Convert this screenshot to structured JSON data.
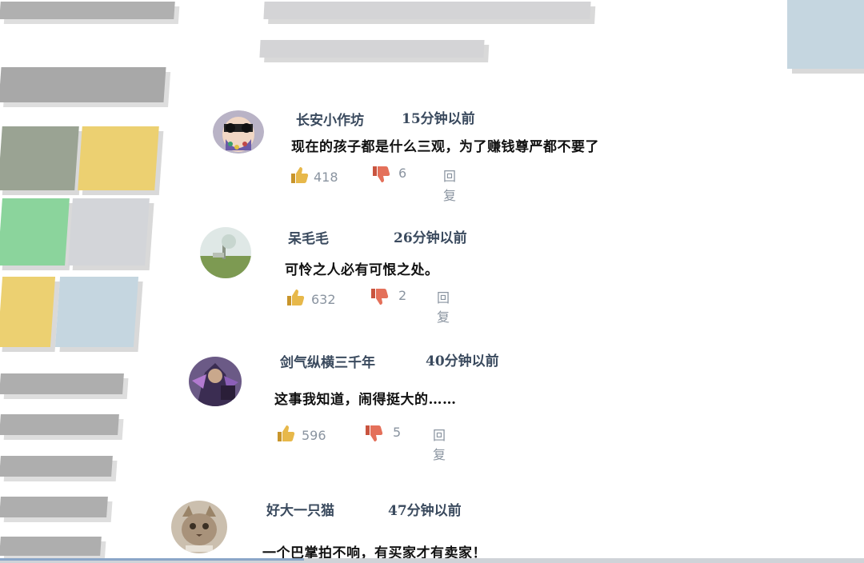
{
  "colors": {
    "gray_bar": "#9c9c9c",
    "light_gray": "#d4d4d6",
    "sage": "#9aa393",
    "yellow": "#ecd071",
    "green": "#8bd49c",
    "silver": "#d3d5d9",
    "light_blue": "#c5d6e0",
    "name_color": "#3a4a5e",
    "like_color": "#e7b84a",
    "dislike_color": "#e4705a"
  },
  "comments": [
    {
      "user": "长安小作坊",
      "time": "15分钟以前",
      "text": "现在的孩子都是什么三观，为了赚钱尊严都不要了",
      "likes": "418",
      "dislikes": "6",
      "reply": "回复",
      "avatar_icon": "sunglasses-avatar-icon"
    },
    {
      "user": "呆毛毛",
      "time": "26分钟以前",
      "text": "可怜之人必有可恨之处。",
      "likes": "632",
      "dislikes": "2",
      "reply": "回复",
      "avatar_icon": "landscape-avatar-icon"
    },
    {
      "user": "剑气纵横三千年",
      "time": "40分钟以前",
      "text": "这事我知道，闹得挺大的……",
      "likes": "596",
      "dislikes": "5",
      "reply": "回复",
      "avatar_icon": "warrior-avatar-icon"
    },
    {
      "user": "好大一只猫",
      "time": "47分钟以前",
      "text": "一个巴掌拍不响，有买家才有卖家！",
      "avatar_icon": "cat-avatar-icon"
    }
  ]
}
